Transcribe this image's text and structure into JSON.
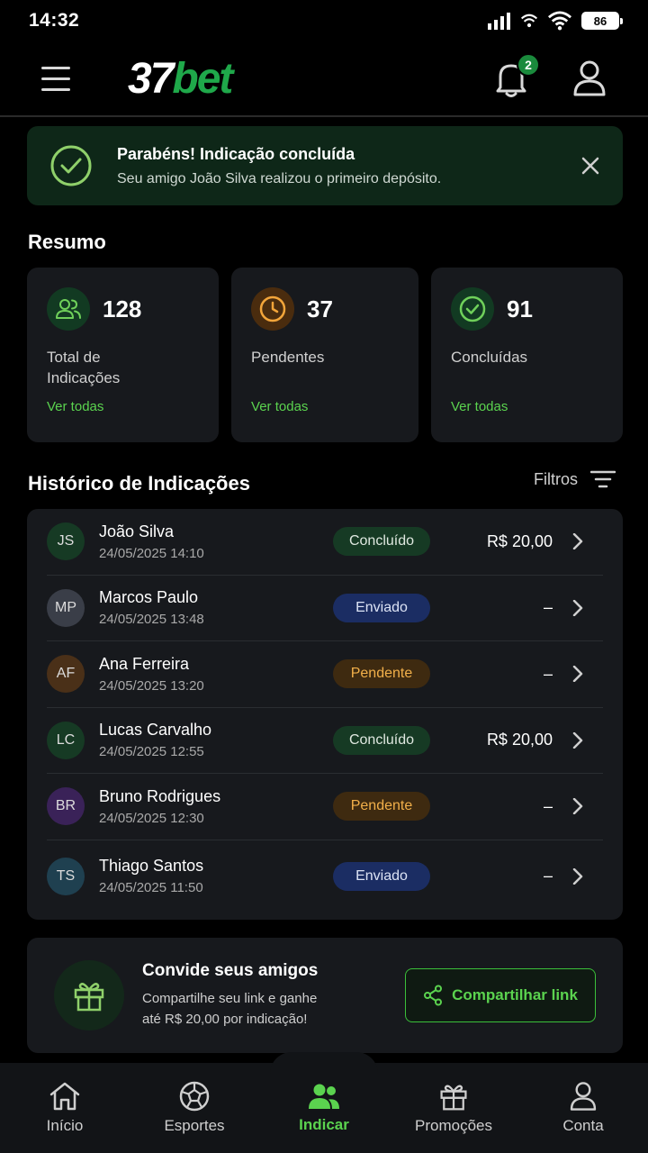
{
  "status_bar": {
    "time": "14:32",
    "battery": "86"
  },
  "header": {
    "logo_num": "37",
    "logo_bet": "bet",
    "notification_count": "2"
  },
  "toast": {
    "title": "Parabéns! Indicação concluída",
    "message": "Seu amigo João Silva realizou o primeiro depósito."
  },
  "summary": {
    "title": "Resumo",
    "cards": [
      {
        "value": "128",
        "label": "Total de Indicações",
        "link": "Ver todas"
      },
      {
        "value": "37",
        "label": "Pendentes",
        "link": "Ver todas"
      },
      {
        "value": "91",
        "label": "Concluídas",
        "link": "Ver todas"
      }
    ]
  },
  "history": {
    "title": "Histórico de Indicações",
    "filters_label": "Filtros",
    "rows": [
      {
        "initials": "JS",
        "name": "João Silva",
        "date": "24/05/2025 14:10",
        "status": "Concluído",
        "amount": "R$ 20,00"
      },
      {
        "initials": "MP",
        "name": "Marcos Paulo",
        "date": "24/05/2025 13:48",
        "status": "Enviado",
        "amount": "–"
      },
      {
        "initials": "AF",
        "name": "Ana Ferreira",
        "date": "24/05/2025 13:20",
        "status": "Pendente",
        "amount": "–"
      },
      {
        "initials": "LC",
        "name": "Lucas Carvalho",
        "date": "24/05/2025 12:55",
        "status": "Concluído",
        "amount": "R$ 20,00"
      },
      {
        "initials": "BR",
        "name": "Bruno Rodrigues",
        "date": "24/05/2025 12:30",
        "status": "Pendente",
        "amount": "–"
      },
      {
        "initials": "TS",
        "name": "Thiago Santos",
        "date": "24/05/2025 11:50",
        "status": "Enviado",
        "amount": "–"
      }
    ]
  },
  "invite": {
    "title": "Convide seus amigos",
    "text_line1": "Compartilhe seu link e ganhe",
    "text_line2": "até R$ 20,00 por indicação!",
    "button_label": "Compartilhar link"
  },
  "bottom_nav": [
    {
      "label": "Início",
      "icon": "home-icon"
    },
    {
      "label": "Esportes",
      "icon": "soccer-ball-icon"
    },
    {
      "label": "Indicar",
      "icon": "users-icon",
      "active": true
    },
    {
      "label": "Promoções",
      "icon": "gift-icon"
    },
    {
      "label": "Conta",
      "icon": "user-icon"
    }
  ],
  "colors": {
    "accent": "#5bd34f",
    "brand_green": "#1fa84a",
    "background": "#000000",
    "card": "#17191d"
  }
}
